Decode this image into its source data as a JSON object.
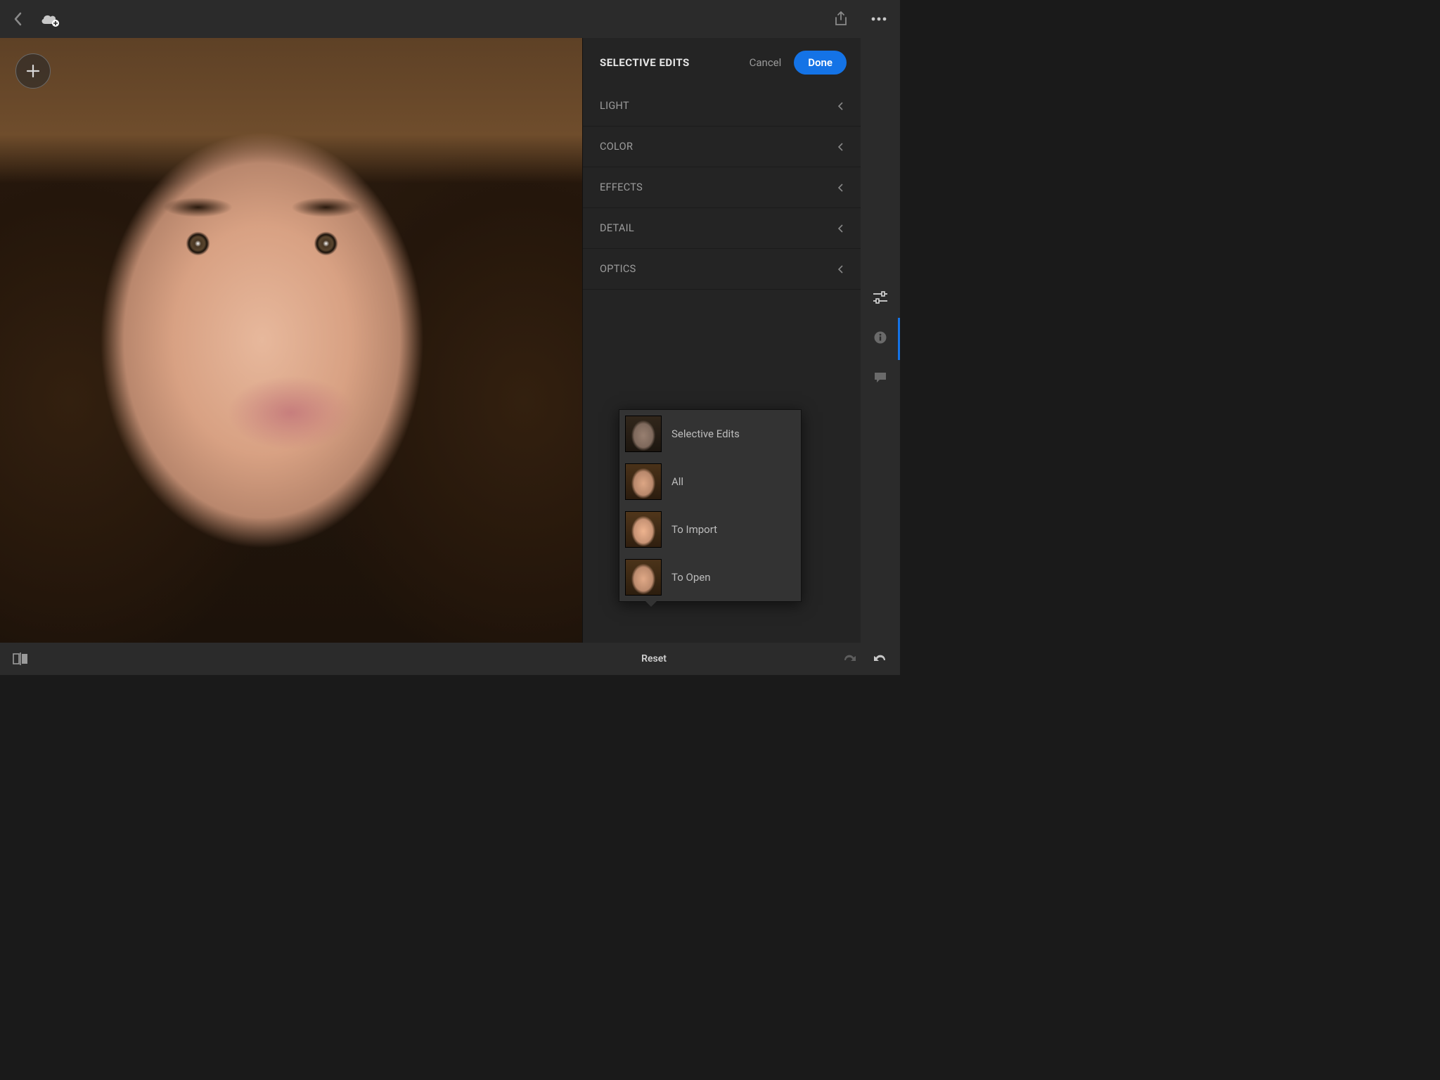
{
  "topbar": {
    "back_icon": "chevron-left",
    "cloud_icon": "cloud-add",
    "share_icon": "share",
    "more_icon": "more"
  },
  "panel": {
    "title": "SELECTIVE EDITS",
    "cancel": "Cancel",
    "done": "Done",
    "sections": [
      "LIGHT",
      "COLOR",
      "EFFECTS",
      "DETAIL",
      "OPTICS"
    ]
  },
  "reset_menu": {
    "items": [
      "Selective Edits",
      "All",
      "To Import",
      "To Open"
    ]
  },
  "bottombar": {
    "compare_icon": "compare",
    "reset_label": "Reset",
    "redo_icon": "redo",
    "undo_icon": "undo"
  },
  "right_rail": {
    "adjust_icon": "sliders",
    "info_icon": "info",
    "comment_icon": "comment"
  },
  "photo": {
    "add_pin_icon": "plus"
  }
}
